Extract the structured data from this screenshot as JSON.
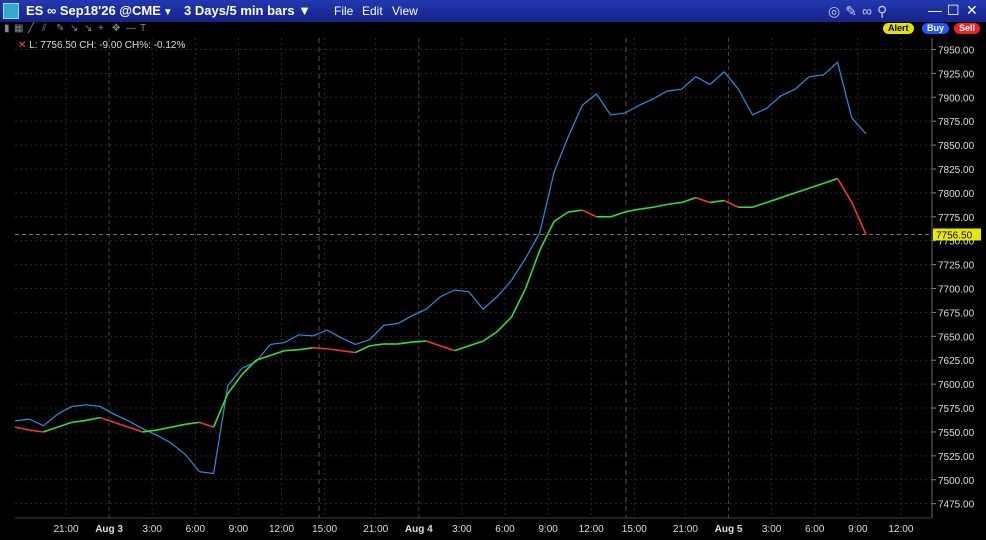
{
  "window": {
    "symbol": "ES ∞ Sep18'26 @CME",
    "period": "3 Days/5 min bars",
    "menus": [
      "File",
      "Edit",
      "View"
    ],
    "buttons": {
      "alert": "Alert",
      "buy": "Buy",
      "sell": "Sell"
    }
  },
  "legend": {
    "last": "L: 7756.50",
    "change": "CH: -9.00",
    "change_pct": "CH%: -0.12%"
  },
  "price_tag": "7756.50",
  "colors": {
    "background": "#000000",
    "blue_line": "#2a8fe0",
    "up": "#33dd33",
    "down": "#ee3333",
    "price_tag": "#e8e800",
    "title_bar": "#1a2a9a"
  },
  "chart_data": {
    "type": "line",
    "y_ticks": [
      "7950.00",
      "7925.00",
      "7900.00",
      "7875.00",
      "7850.00",
      "7825.00",
      "7800.00",
      "7775.00",
      "7750.00",
      "7725.00",
      "7700.00",
      "7675.00",
      "7650.00",
      "7625.00",
      "7600.00",
      "7575.00",
      "7550.00",
      "7525.00",
      "7500.00",
      "7475.00"
    ],
    "ylim": [
      7460,
      7962
    ],
    "x_ticks": [
      "21:00",
      "Aug 3",
      "3:00",
      "6:00",
      "9:00",
      "12:00",
      "15:00",
      "21:00",
      "Aug 4",
      "3:00",
      "6:00",
      "9:00",
      "12:00",
      "15:00",
      "21:00",
      "Aug 5",
      "3:00",
      "6:00",
      "9:00",
      "12:00"
    ],
    "grid": true,
    "current_price": 7756.5,
    "series": [
      {
        "values": [
          7560,
          7565,
          7555,
          7570,
          7575,
          7580,
          7575,
          7570,
          7560,
          7555,
          7545,
          7540,
          7525,
          7510,
          7505,
          7600,
          7615,
          7625,
          7640,
          7645,
          7650,
          7652,
          7655,
          7650,
          7640,
          7648,
          7660,
          7665,
          7670,
          7680,
          7690,
          7700,
          7695,
          7680,
          7690,
          7710,
          7730,
          7760,
          7820,
          7860,
          7890,
          7905,
          7880,
          7885,
          7890,
          7900,
          7905,
          7910,
          7920,
          7915,
          7925,
          7910,
          7880,
          7890,
          7900,
          7910,
          7920,
          7925,
          7935,
          7880,
          7860
        ]
      },
      {
        "values": [
          7555,
          7552,
          7550,
          7555,
          7560,
          7562,
          7565,
          7560,
          7555,
          7550,
          7552,
          7555,
          7558,
          7560,
          7555,
          7590,
          7610,
          7625,
          7630,
          7635,
          7636,
          7638,
          7637,
          7635,
          7633,
          7640,
          7642,
          7642,
          7644,
          7645,
          7640,
          7635,
          7640,
          7645,
          7655,
          7670,
          7700,
          7740,
          7770,
          7780,
          7782,
          7775,
          7775,
          7780,
          7783,
          7785,
          7788,
          7790,
          7795,
          7790,
          7792,
          7785,
          7785,
          7790,
          7795,
          7800,
          7805,
          7810,
          7815,
          7790,
          7756.5
        ]
      }
    ]
  }
}
